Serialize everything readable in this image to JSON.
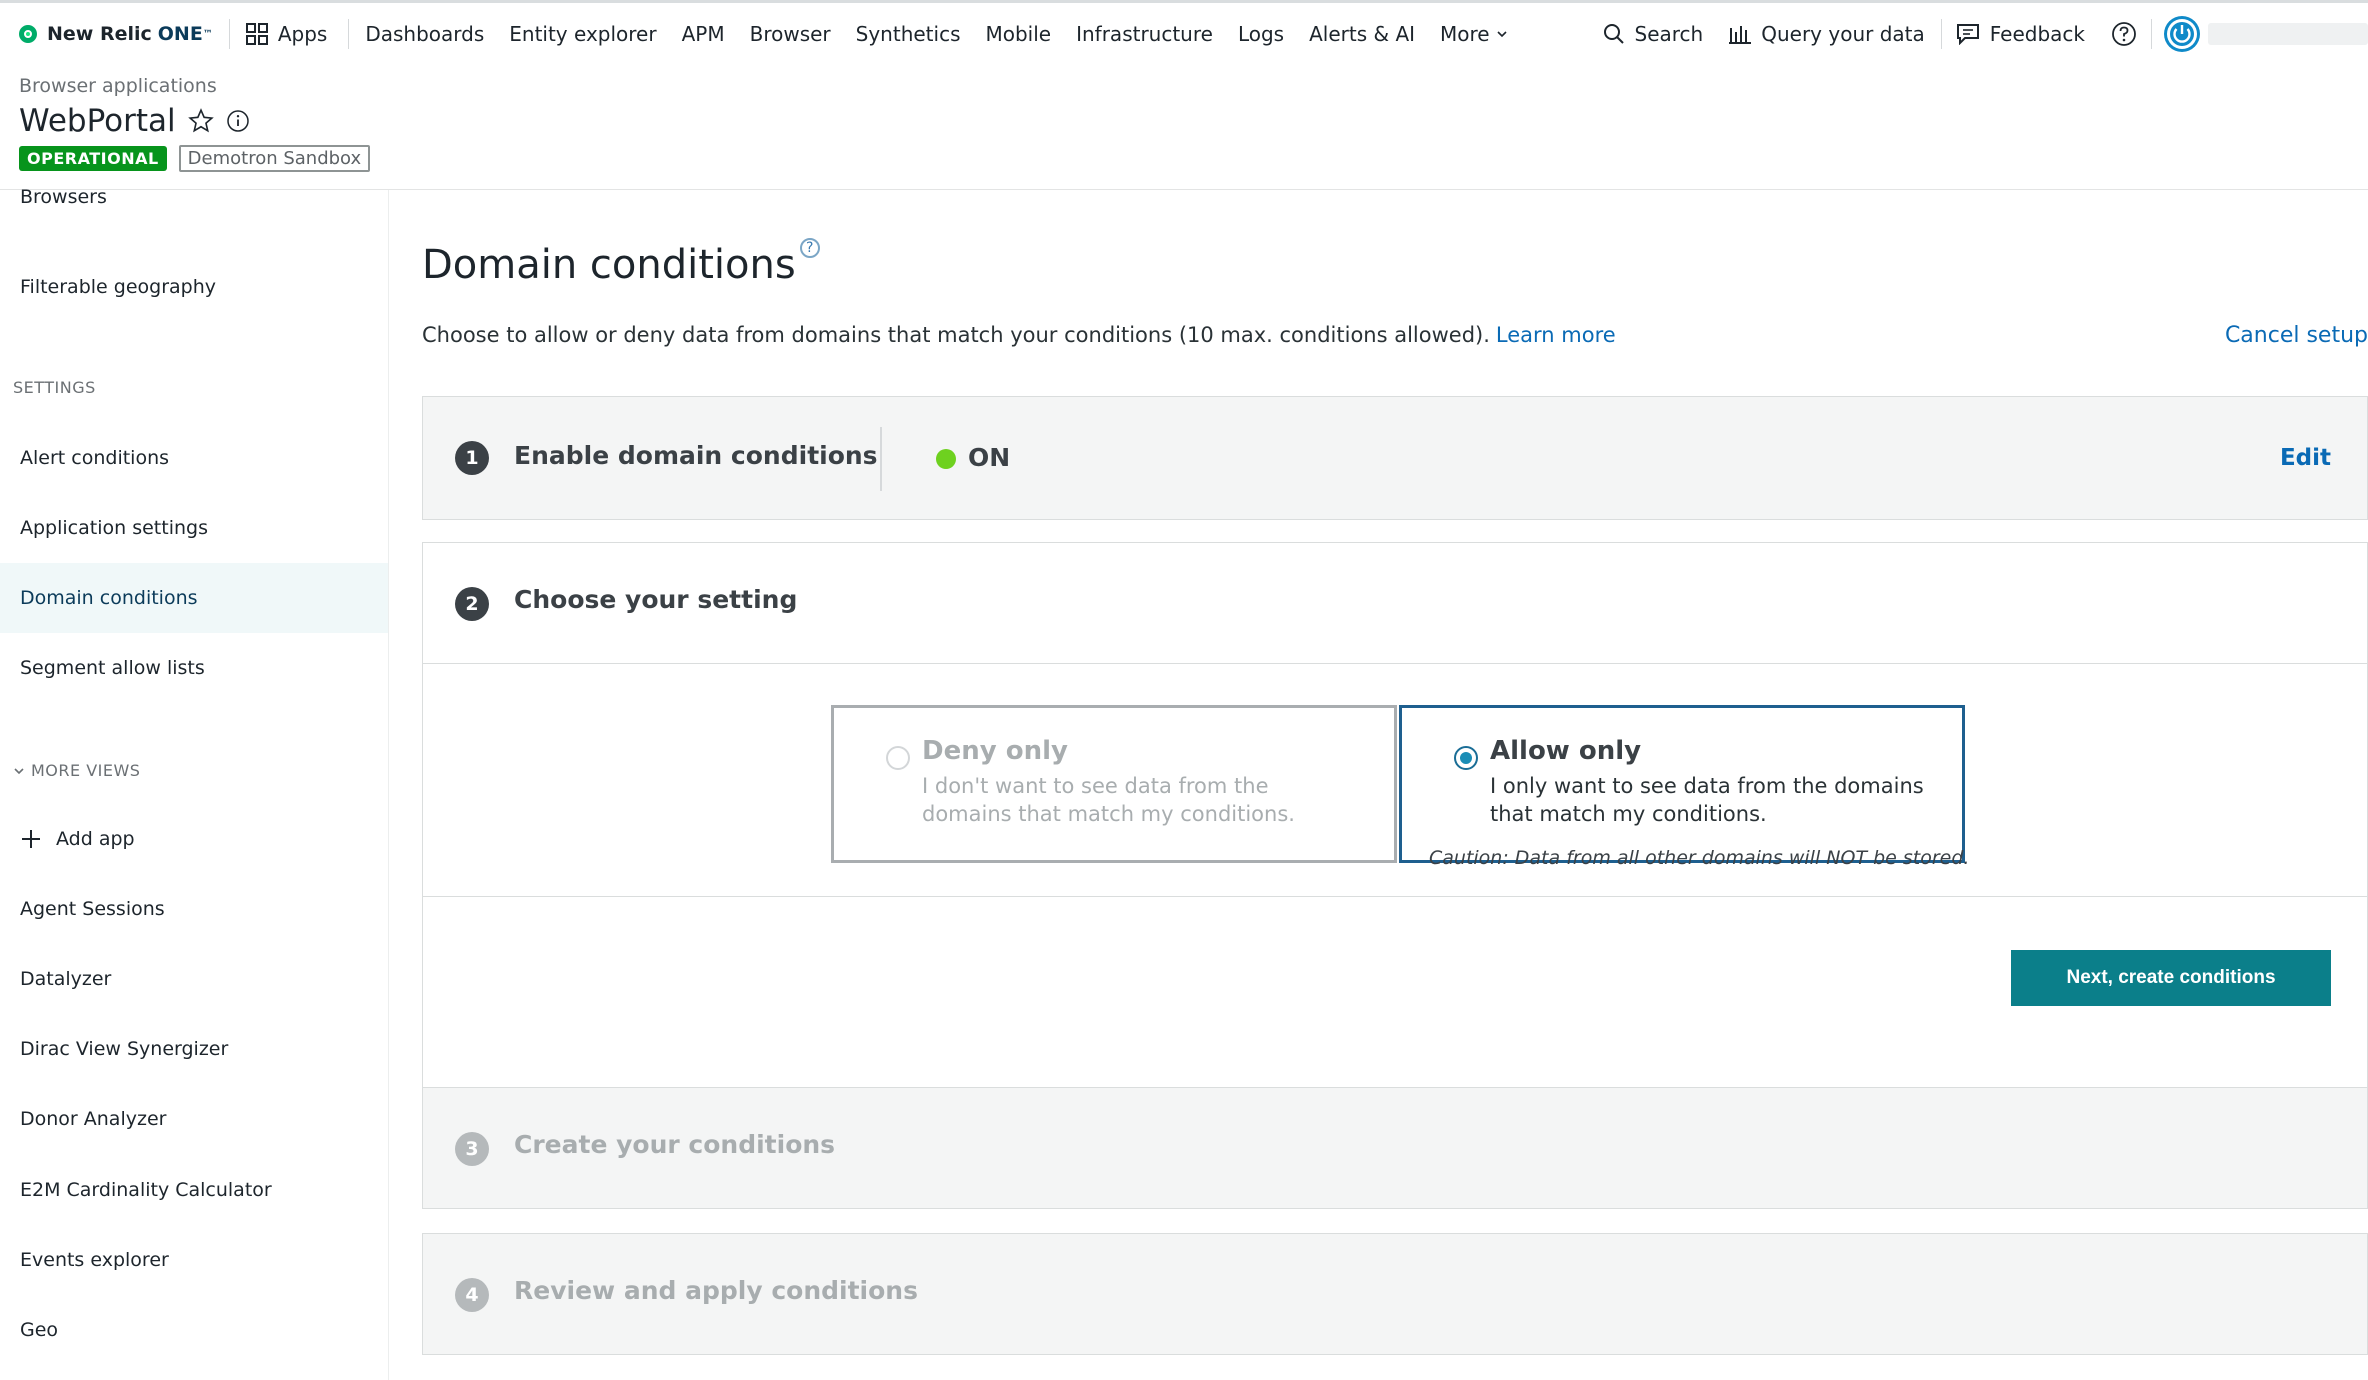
{
  "nav": {
    "logo_text": "New Relic",
    "logo_one": "ONE",
    "logo_tm": "™",
    "items": [
      "Apps",
      "Dashboards",
      "Entity explorer",
      "APM",
      "Browser",
      "Synthetics",
      "Mobile",
      "Infrastructure",
      "Logs",
      "Alerts & AI",
      "More"
    ],
    "search_label": "Search",
    "query_label": "Query your data",
    "feedback_label": "Feedback"
  },
  "header": {
    "breadcrumb": "Browser applications",
    "title": "WebPortal",
    "status_badge": "OPERATIONAL",
    "account_badge": "Demotron Sandbox"
  },
  "sidebar": {
    "top_items": [
      "Browsers",
      "Filterable geography"
    ],
    "settings_label": "SETTINGS",
    "settings_items": [
      "Alert conditions",
      "Application settings",
      "Domain conditions",
      "Segment allow lists"
    ],
    "active_item": "Domain conditions",
    "more_views_label": "MORE VIEWS",
    "add_app_label": "Add app",
    "more_items": [
      "Agent Sessions",
      "Datalyzer",
      "Dirac View Synergizer",
      "Donor Analyzer",
      "E2M Cardinality Calculator",
      "Events explorer",
      "Geo"
    ]
  },
  "main": {
    "title": "Domain conditions",
    "help_glyph": "?",
    "description": "Choose to allow or deny data from domains that match your conditions (10 max. conditions allowed).",
    "learn_more": "Learn more",
    "cancel_setup": "Cancel setup",
    "steps": [
      {
        "number": "1",
        "title": "Enable domain conditions",
        "status": "ON",
        "action": "Edit"
      },
      {
        "number": "2",
        "title": "Choose your setting"
      },
      {
        "number": "3",
        "title": "Create your conditions"
      },
      {
        "number": "4",
        "title": "Review and apply conditions"
      }
    ],
    "choices": {
      "deny": {
        "title": "Deny only",
        "description": "I don't want to see data from the domains that match my conditions.",
        "selected": false
      },
      "allow": {
        "title": "Allow only",
        "description": "I only want to see data from the domains that match my conditions.",
        "selected": true
      }
    },
    "caution": "Caution: Data from all other domains will NOT be stored.",
    "next_button": "Next, create conditions"
  },
  "colors": {
    "operational": "#07941c",
    "on_indicator": "#6ed11f",
    "primary_button": "#0b7f8a",
    "link": "#0a6ab5",
    "active_sidebar_bg": "#f0f8f9"
  }
}
